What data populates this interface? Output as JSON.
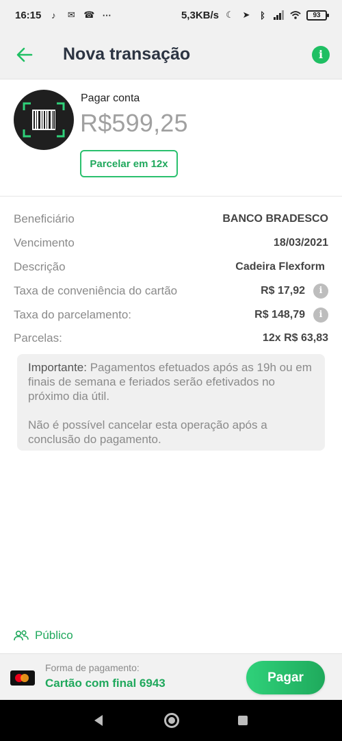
{
  "status_bar": {
    "time": "16:15",
    "network_speed": "5,3KB/s",
    "battery": "93",
    "left_icons": [
      "tiktok-icon",
      "mail-icon",
      "app-icon",
      "more-dots-icon"
    ],
    "right_icons": [
      "moon-icon",
      "location-icon",
      "bluetooth-icon",
      "signal-icon",
      "wifi-icon"
    ]
  },
  "app_bar": {
    "title": "Nova transação",
    "back_icon": "arrow-left-icon",
    "info_icon": "info-icon",
    "info_glyph": "i"
  },
  "payment": {
    "label": "Pagar conta",
    "amount": "R$599,25",
    "installment_button": "Parcelar em 12x"
  },
  "details": {
    "beneficiary_label": "Beneficiário",
    "beneficiary_value": "BANCO BRADESCO",
    "due_label": "Vencimento",
    "due_value": "18/03/2021",
    "description_label": "Descrição",
    "description_value": "Cadeira Flexform",
    "card_fee_label": "Taxa de conveniência do cartão",
    "card_fee_value": "R$ 17,92",
    "installment_fee_label": "Taxa do parcelamento:",
    "installment_fee_value": "R$ 148,79",
    "installments_label": "Parcelas:",
    "installments_value": "12x R$ 63,83",
    "info_glyph": "i"
  },
  "notice": {
    "strong": "Importante:",
    "text1": " Pagamentos efetuados após as 19h ou em finais de semana e feriados serão efetivados no próximo dia útil.",
    "text2": "Não é possível cancelar esta operação após a conclusão do pagamento."
  },
  "visibility": {
    "label": "Público",
    "icon": "people-icon"
  },
  "payment_bar": {
    "method_label": "Forma de pagamento:",
    "method_value": "Cartão com final 6943",
    "pay_button": "Pagar",
    "card_brand_icon": "mastercard-icon"
  },
  "colors": {
    "accent": "#1fbf63",
    "accent_dark": "#1fa85c",
    "title": "#2c3442",
    "muted": "#8a8a8a"
  }
}
